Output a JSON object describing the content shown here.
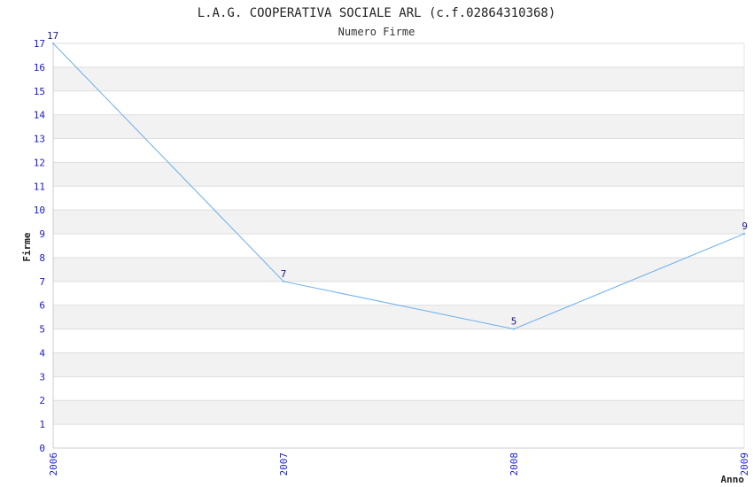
{
  "chart_data": {
    "type": "line",
    "title": "L.A.G. COOPERATIVA SOCIALE ARL (c.f.02864310368)",
    "subtitle": "Numero Firme",
    "xlabel": "Anno",
    "ylabel": "Firme",
    "x": [
      "2006",
      "2007",
      "2008",
      "2009"
    ],
    "values": [
      17,
      7,
      5,
      9
    ],
    "data_labels": [
      "17",
      "7",
      "5",
      "9"
    ],
    "ylim": [
      0,
      17
    ],
    "yticks": [
      "0",
      "1",
      "2",
      "3",
      "4",
      "5",
      "6",
      "7",
      "8",
      "9",
      "10",
      "11",
      "12",
      "13",
      "14",
      "15",
      "16",
      "17"
    ],
    "grid": true,
    "legend": "none",
    "colors": {
      "line": "#6aaef0",
      "band": "#f2f2f2",
      "gridline": "#dddddd",
      "tick_text": "#1a1acc",
      "data_label_text": "#1a1a80"
    }
  }
}
